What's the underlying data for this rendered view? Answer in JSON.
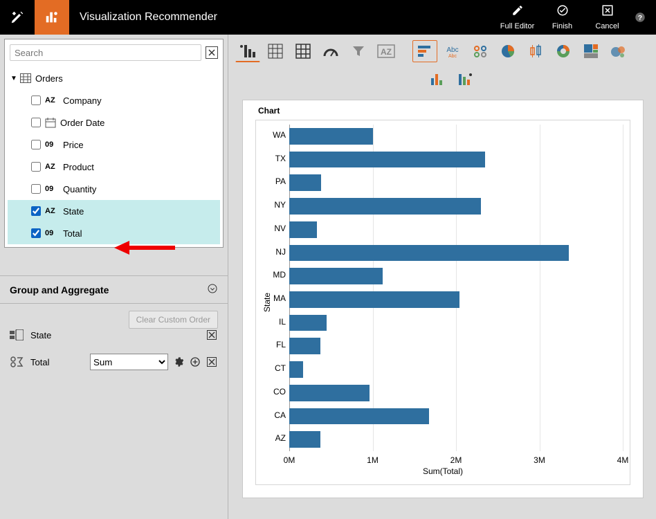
{
  "header": {
    "title": "Visualization Recommender",
    "actions": {
      "full_editor": "Full Editor",
      "finish": "Finish",
      "cancel": "Cancel"
    }
  },
  "search": {
    "placeholder": "Search"
  },
  "tree": {
    "dataset": "Orders",
    "fields": [
      {
        "name": "Company",
        "type": "AZ",
        "checked": false,
        "selected": false
      },
      {
        "name": "Order Date",
        "type": "DATE",
        "checked": false,
        "selected": false
      },
      {
        "name": "Price",
        "type": "09",
        "checked": false,
        "selected": false
      },
      {
        "name": "Product",
        "type": "AZ",
        "checked": false,
        "selected": false
      },
      {
        "name": "Quantity",
        "type": "09",
        "checked": false,
        "selected": false
      },
      {
        "name": "State",
        "type": "AZ",
        "checked": true,
        "selected": true
      },
      {
        "name": "Total",
        "type": "09",
        "checked": true,
        "selected": true
      }
    ]
  },
  "group": {
    "header": "Group and Aggregate",
    "clear_btn": "Clear Custom Order",
    "rows": {
      "state": "State",
      "total": "Total",
      "agg_selected": "Sum"
    }
  },
  "chart_data": {
    "type": "bar",
    "orientation": "horizontal",
    "title": "Chart",
    "xlabel": "Sum(Total)",
    "ylabel": "State",
    "xlim": [
      0,
      4000000
    ],
    "xticks": [
      {
        "v": 0,
        "label": "0M"
      },
      {
        "v": 1000000,
        "label": "1M"
      },
      {
        "v": 2000000,
        "label": "2M"
      },
      {
        "v": 3000000,
        "label": "3M"
      },
      {
        "v": 4000000,
        "label": "4M"
      }
    ],
    "categories": [
      "WA",
      "TX",
      "PA",
      "NY",
      "NV",
      "NJ",
      "MD",
      "MA",
      "IL",
      "FL",
      "CT",
      "CO",
      "CA",
      "AZ"
    ],
    "values": [
      1000000,
      2350000,
      380000,
      2300000,
      330000,
      3350000,
      1120000,
      2040000,
      450000,
      370000,
      170000,
      960000,
      1680000,
      370000
    ]
  }
}
